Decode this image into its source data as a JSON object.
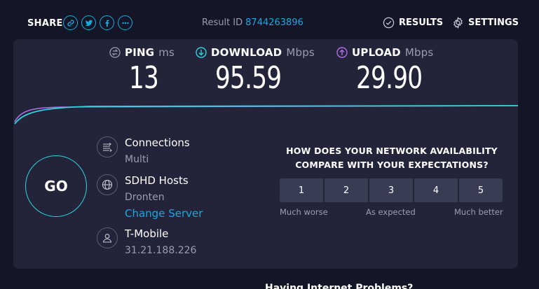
{
  "header": {
    "share_label": "SHARE",
    "share_icons": [
      "link-icon",
      "twitter-icon",
      "facebook-icon",
      "more-icon"
    ],
    "result_label": "Result ID",
    "result_id": "8744263896",
    "results_label": "RESULTS",
    "settings_label": "SETTINGS"
  },
  "metrics": {
    "ping": {
      "label": "PING",
      "unit": "ms",
      "value": "13"
    },
    "download": {
      "label": "DOWNLOAD",
      "unit": "Mbps",
      "value": "95.59"
    },
    "upload": {
      "label": "UPLOAD",
      "unit": "Mbps",
      "value": "29.90"
    }
  },
  "go_label": "GO",
  "info": {
    "connections": {
      "title": "Connections",
      "value": "Multi"
    },
    "host": {
      "title": "SDHD Hosts",
      "value": "Dronten",
      "change_label": "Change Server"
    },
    "isp": {
      "title": "T-Mobile",
      "ip": "31.21.188.226"
    }
  },
  "survey": {
    "question_line1": "HOW DOES YOUR NETWORK AVAILABILITY",
    "question_line2": "COMPARE WITH YOUR EXPECTATIONS?",
    "options": [
      "1",
      "2",
      "3",
      "4",
      "5"
    ],
    "low_label": "Much worse",
    "mid_label": "As expected",
    "high_label": "Much better"
  },
  "footer_partial": "Having Internet Problems?",
  "colors": {
    "accent": "#1ca8dd",
    "download": "#2dd5db",
    "upload": "#b36ee8",
    "background": "#141526",
    "card": "#23243a"
  }
}
